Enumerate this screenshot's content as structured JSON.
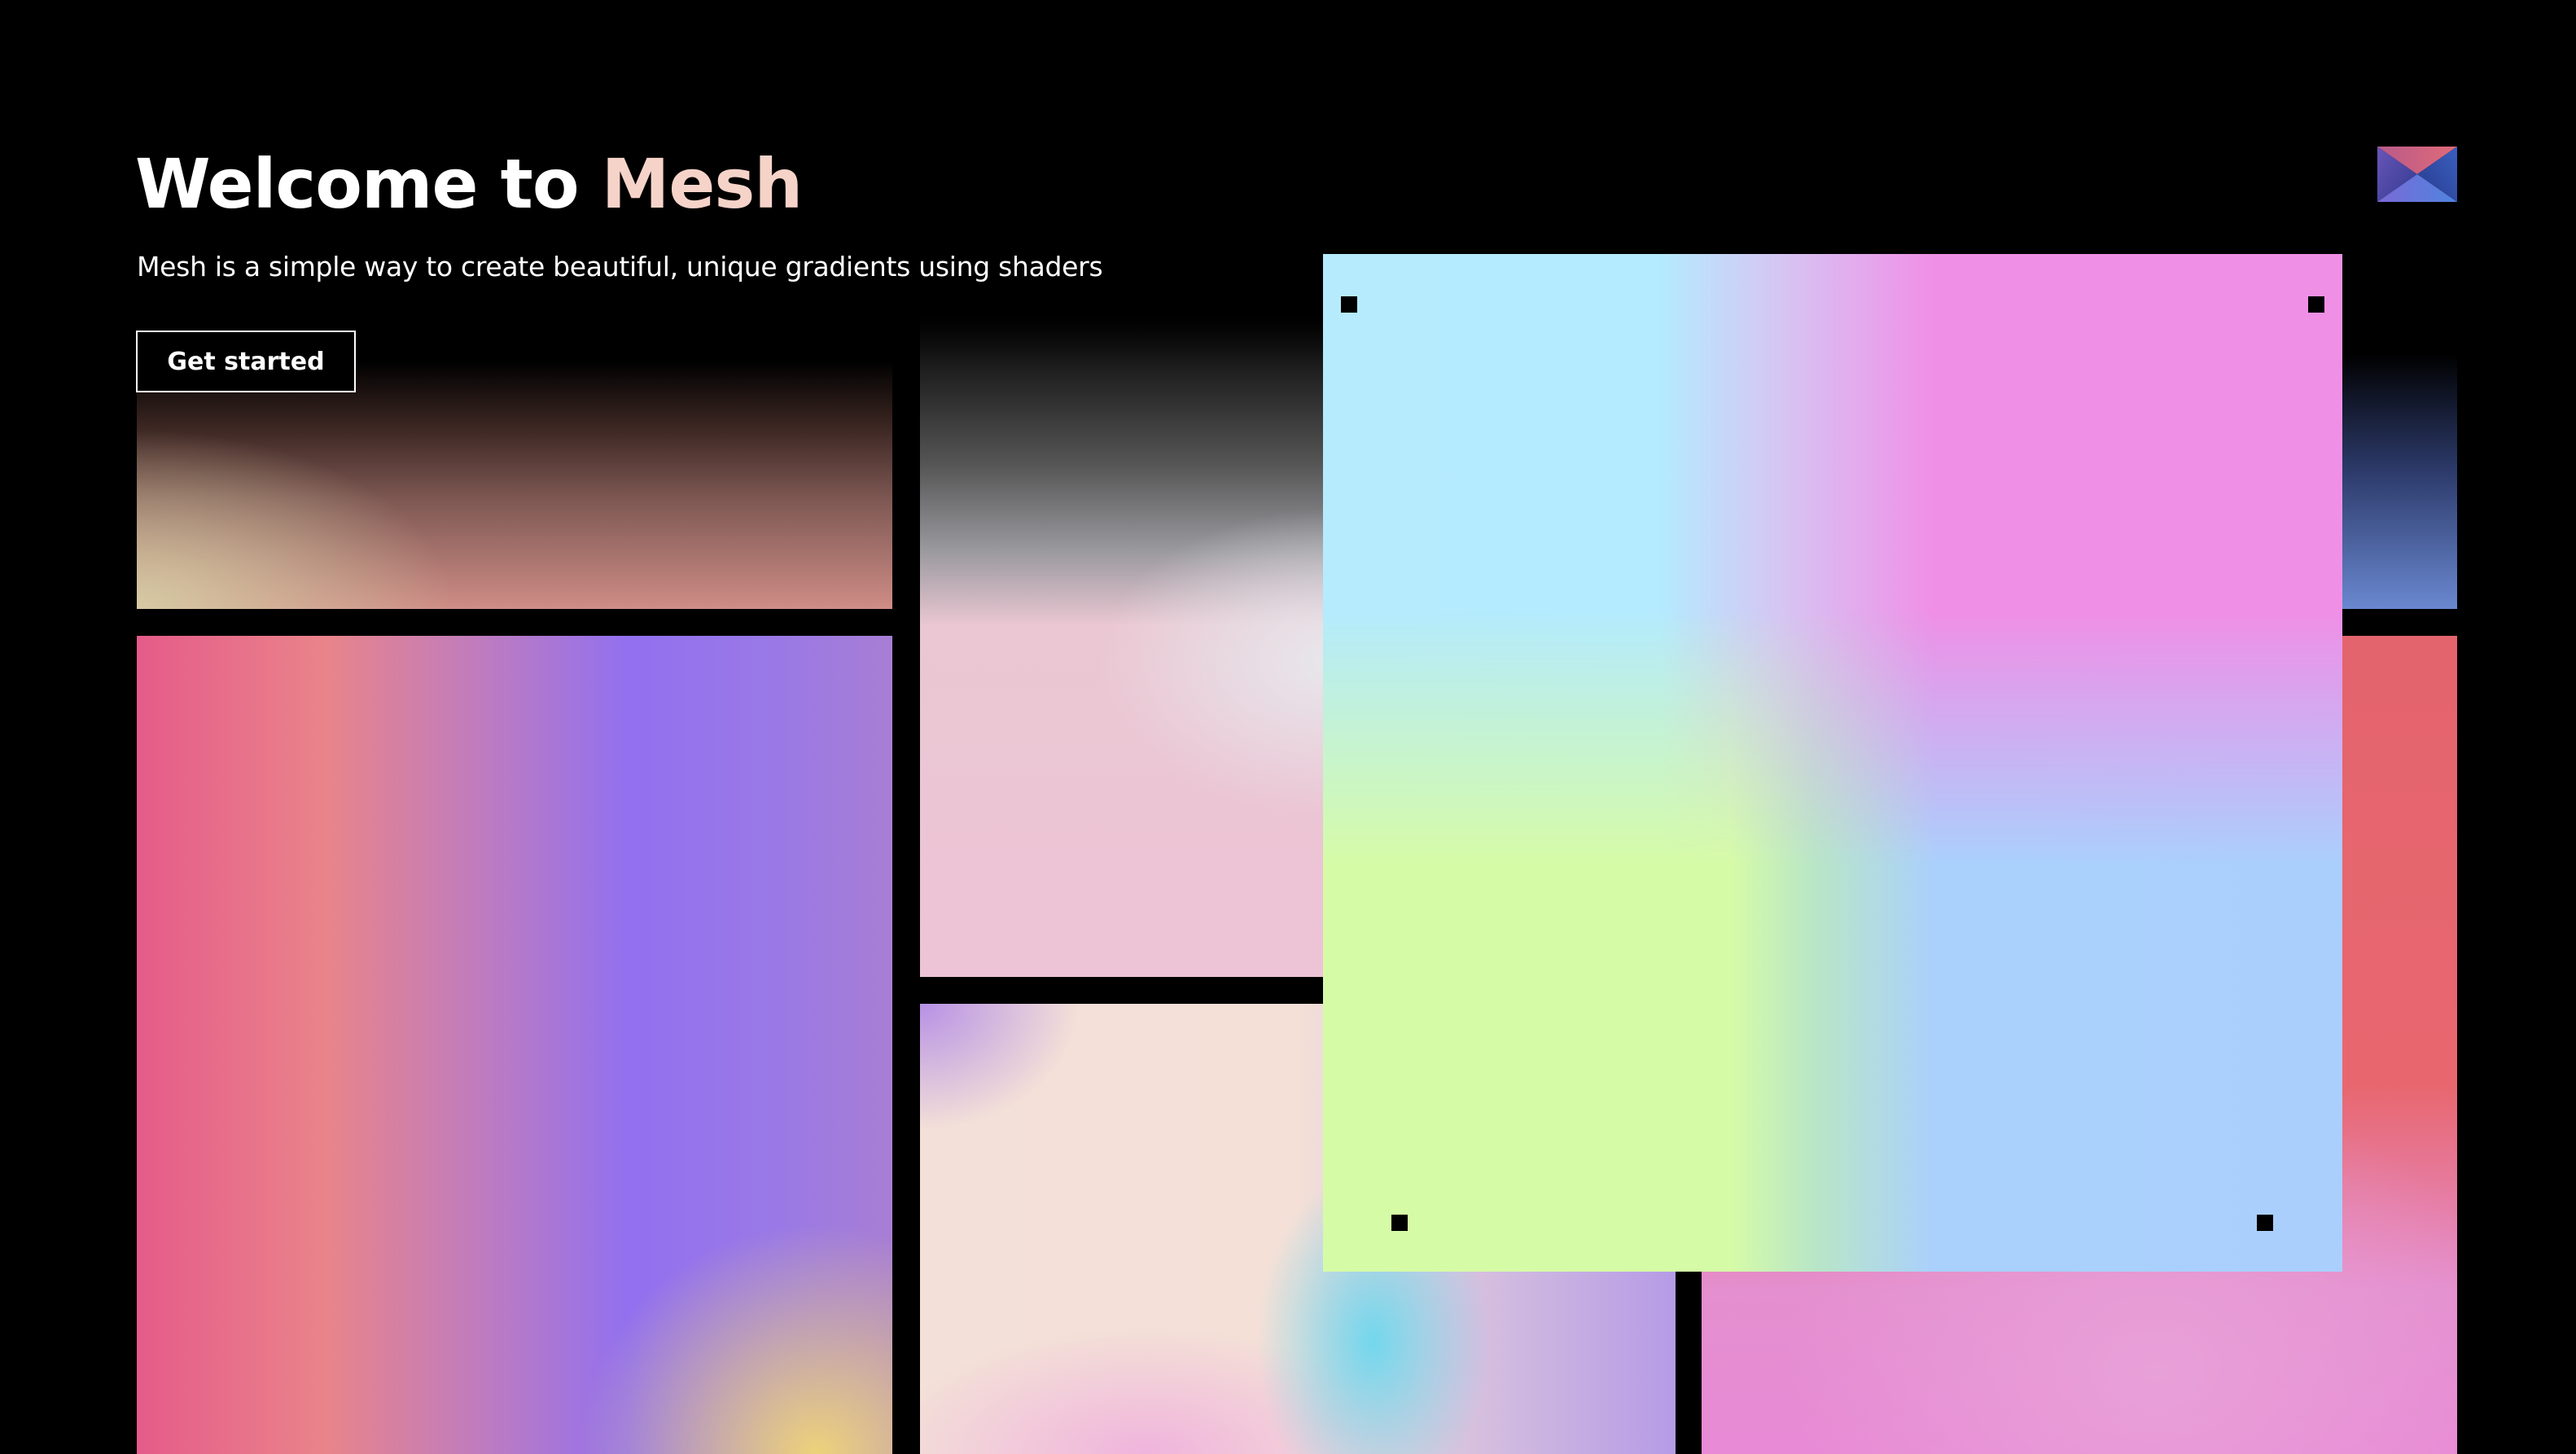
{
  "header": {
    "title_prefix": "Welcome to ",
    "title_accent": "Mesh",
    "subtitle": "Mesh is a simple way to create beautiful, unique gradients using shaders",
    "cta_label": "Get started"
  },
  "logo": {
    "icon": "mesh-logo-icon"
  },
  "colors": {
    "background": "#000000",
    "text": "#ffffff",
    "title_accent": "#f6d3c9",
    "editor_gradient_stops": [
      "#b5ebfd",
      "#f08fe6",
      "#d6fba7",
      "#aacffd"
    ]
  },
  "editor": {
    "control_points": [
      "top-left",
      "top-right",
      "bottom-left",
      "bottom-right"
    ]
  }
}
